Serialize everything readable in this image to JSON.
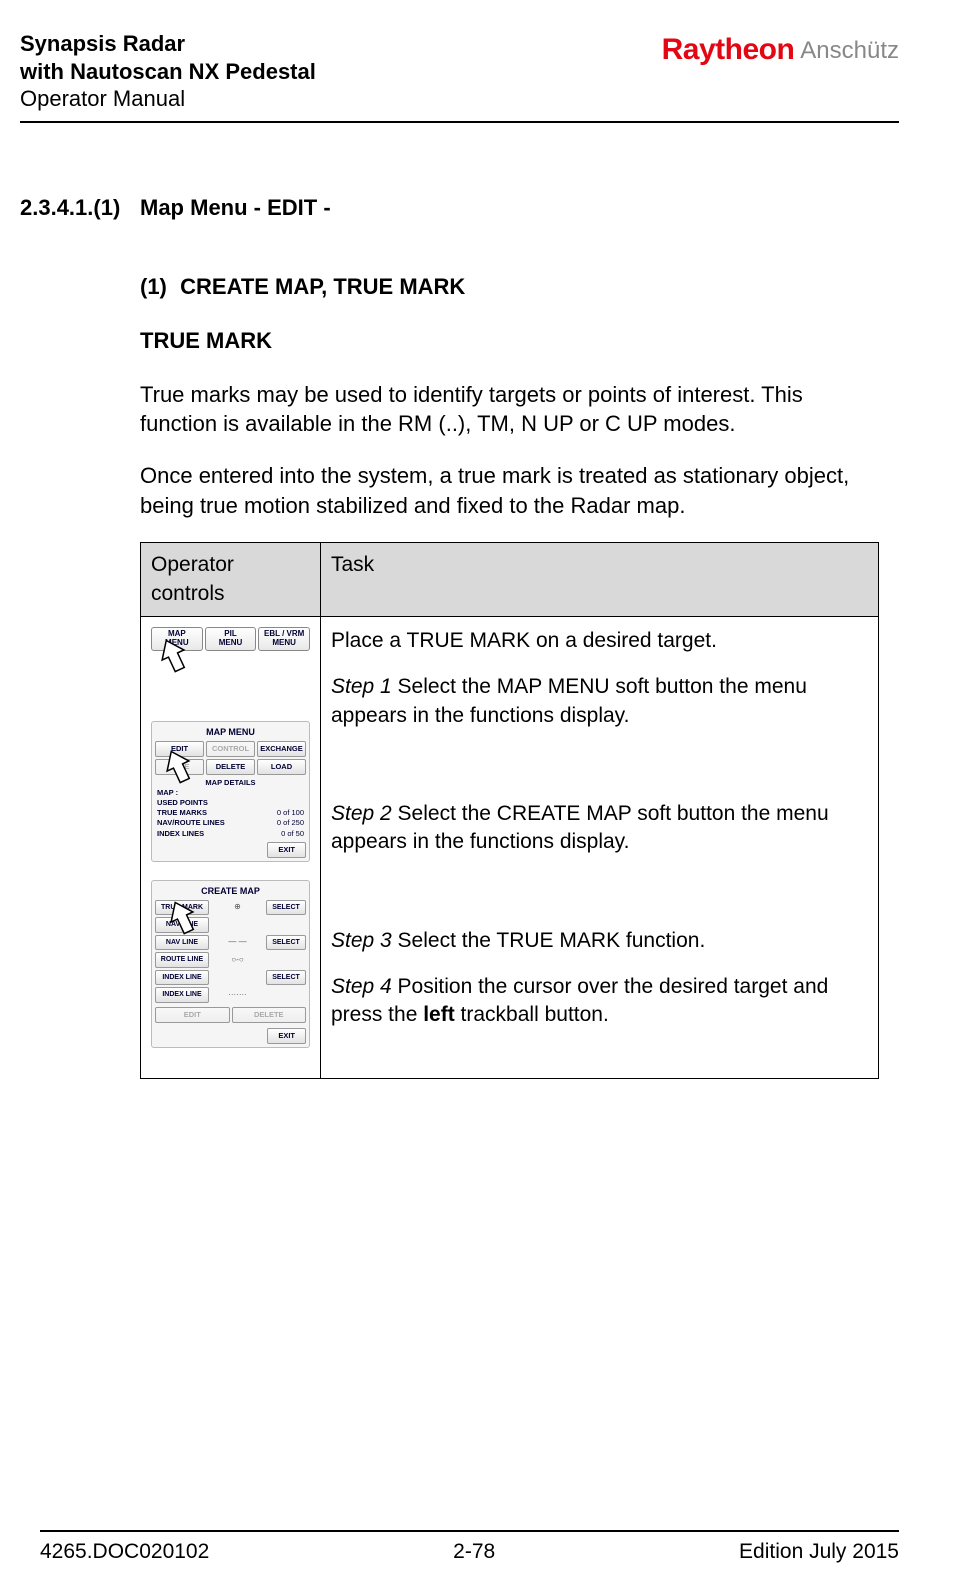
{
  "header": {
    "product_line1": "Synapsis Radar",
    "product_line2": "with Nautoscan NX Pedestal",
    "doc_type": "Operator Manual",
    "logo_brand": "Raytheon",
    "logo_sub": "Anschütz"
  },
  "section": {
    "number": "2.3.4.1.(1)",
    "title": "Map Menu - EDIT -"
  },
  "subsection": {
    "number": "(1)",
    "title": "CREATE MAP, TRUE MARK"
  },
  "heading": "TRUE MARK",
  "para1": "True marks may be used to identify targets or points of interest. This function is available in the RM (..), TM, N UP or C UP modes.",
  "para2": "Once entered into the system, a true mark is treated as stationary object, being true motion stabilized and fixed to the Radar map.",
  "table": {
    "col1": "Operator controls",
    "col2": "Task",
    "intro": "Place a TRUE MARK on a desired target.",
    "step1_label": "Step 1",
    "step1_text": " Select the MAP MENU soft button the menu appears in the functions display.",
    "step2_label": "Step 2",
    "step2_text": " Select the CREATE MAP soft button the menu appears in the functions display.",
    "step3_label": "Step 3",
    "step3_text": " Select the TRUE MARK function.",
    "step4_label": "Step 4",
    "step4_text_a": " Position the cursor over the desired target and press the ",
    "step4_bold": "left",
    "step4_text_b": " trackball button."
  },
  "softmenu": {
    "b1_l1": "MAP",
    "b1_l2": "MENU",
    "b2_l1": "PIL",
    "b2_l2": "MENU",
    "b3_l1": "EBL / VRM",
    "b3_l2": "MENU"
  },
  "mapmenu": {
    "title": "MAP MENU",
    "edit": "EDIT",
    "control": "CONTROL",
    "exchange": "EXCHANGE",
    "save": "SAVE",
    "delete": "DELETE",
    "load": "LOAD",
    "details_hdr": "MAP DETAILS",
    "map_label": "MAP :",
    "used_points": "USED POINTS",
    "true_marks_l": "TRUE MARKS",
    "true_marks_v": "0  of   100",
    "nav_lines_l": "NAV/ROUTE LINES",
    "nav_lines_v": "0  of   250",
    "index_lines_l": "INDEX LINES",
    "index_lines_v": "0  of    50",
    "exit": "EXIT"
  },
  "createmap": {
    "title": "CREATE MAP",
    "true_mark": "TRUE MARK",
    "nav_line": "NAV LINE",
    "route_line": "ROUTE LINE",
    "index_line": "INDEX LINE",
    "select": "SELECT",
    "edit": "EDIT",
    "delete": "DELETE",
    "exit": "EXIT",
    "sym_cross": "⊕",
    "sym_dash": "— —",
    "sym_chain": "○-○",
    "sym_dots": "·······"
  },
  "footer": {
    "doc": "4265.DOC020102",
    "page": "2-78",
    "edition": "Edition July 2015"
  }
}
